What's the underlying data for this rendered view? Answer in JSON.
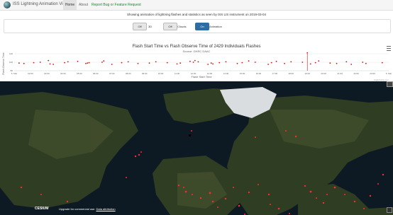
{
  "app": {
    "title": "ISS Lightning Animation Viewer"
  },
  "nav": {
    "home": "Home",
    "about": "About",
    "report": "Report Bug or Feature Request"
  },
  "status": "Showing animation of lightning flashes and statistics as seen by ISS LIS instrument on 2019-03-04",
  "controls": [
    {
      "state": "Off",
      "label": "3D"
    },
    {
      "state": "Off",
      "label": "Clouds"
    },
    {
      "state": "On",
      "label": "Animation"
    }
  ],
  "colors": {
    "accent": "#2e6da4",
    "flash": "#cc1111",
    "brand_green": "#1b8a2c"
  },
  "chart_data": {
    "type": "scatter",
    "title": "Flash Start Time vs Flash Observe Time of 2429 Individuals Flashes",
    "subtitle": "Source: GHRC DAAC",
    "xlabel": "Flash Start Time",
    "ylabel": "Flash Observe Time",
    "y_ticks": [
      "120",
      "100",
      "80"
    ],
    "x_ticks": [
      "5. Mar",
      "02:00",
      "03:00",
      "04:00",
      "05:00",
      "06:00",
      "07:00",
      "08:00",
      "09:00",
      "10:00",
      "11:00",
      "12:00",
      "13:00",
      "14:00",
      "15:00",
      "16:00",
      "17:00",
      "18:00",
      "19:00",
      "20:00",
      "21:00",
      "22:00",
      "23:00",
      "5. Mar"
    ],
    "grid": true,
    "series": [
      {
        "x": [
          0.3,
          0.6,
          1.2,
          1.6,
          2.1,
          2.2,
          2.4,
          3.1,
          3.3,
          3.9,
          4.4,
          4.5,
          4.6,
          5.4,
          5.5,
          6.0,
          6.6,
          7.0,
          7.6,
          8.3,
          8.7,
          9.4,
          10.0,
          10.2,
          10.8,
          11.0,
          11.1,
          11.3,
          11.9,
          12.1,
          12.2,
          12.6,
          13.0,
          13.7,
          14.0,
          14.4,
          14.8,
          15.6,
          15.8,
          16.1,
          16.6,
          17.0,
          17.7,
          18.0,
          18.2,
          18.5,
          18.7,
          19.4,
          19.8,
          20.4,
          20.7,
          21.4,
          21.6,
          22.6
        ],
        "y": [
          98,
          97,
          99,
          100,
          104,
          96,
          95,
          99,
          101,
          102,
          97,
          98,
          99,
          100,
          103,
          95,
          99,
          101,
          97,
          98,
          101,
          99,
          96,
          98,
          102,
          100,
          104,
          101,
          95,
          98,
          96,
          99,
          101,
          97,
          99,
          103,
          100,
          95,
          99,
          102,
          97,
          101,
          100,
          122,
          96,
          99,
          103,
          98,
          97,
          101,
          95,
          100,
          97,
          99
        ]
      }
    ]
  },
  "globe": {
    "logo": "CESIUM",
    "upgrade_text": "Upgrade for commercial use.",
    "attribution": "Data attribution"
  }
}
